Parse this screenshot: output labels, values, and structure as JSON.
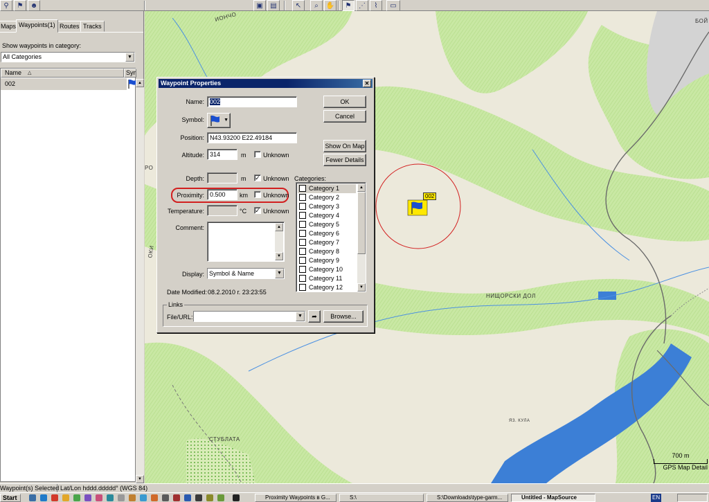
{
  "toolbar": {
    "buttons": [
      "binoculars-find",
      "find-next",
      "find-user",
      "save-waypoint",
      "print",
      "select-tool",
      "zoom-tool",
      "pan-tool",
      "waypoint-tool",
      "route-tool",
      "track-tool",
      "measure-tool"
    ]
  },
  "left_panel": {
    "tabs": [
      {
        "label": "Maps"
      },
      {
        "label": "Waypoints(1)"
      },
      {
        "label": "Routes"
      },
      {
        "label": "Tracks"
      }
    ],
    "show_label": "Show waypoints in category:",
    "category_select": "All Categories",
    "columns": {
      "name": "Name",
      "sym": "Sym"
    },
    "rows": [
      {
        "name": "002"
      }
    ]
  },
  "map": {
    "labels": {
      "top_left": "ИОНЧО",
      "top_right": "БОЙ",
      "river": "НИЩОРСКИ ДОЛ",
      "lake": "ЯЗ. КУЛА",
      "bottom": "СТУБЛАТА",
      "left_a": "РО",
      "left_b": "ОКИ"
    },
    "waypoint_label": "002",
    "scale_text": "700 m",
    "detail_text": "GPS Map Detail"
  },
  "dialog": {
    "title": "Waypoint Properties",
    "labels": {
      "name": "Name:",
      "symbol": "Symbol:",
      "position": "Position:",
      "altitude": "Altitude:",
      "depth": "Depth:",
      "proximity": "Proximity:",
      "temperature": "Temperature:",
      "comment": "Comment:",
      "display": "Display:",
      "date_modified": "Date Modified:",
      "categories": "Categories:",
      "links": "Links",
      "file_url": "File/URL:"
    },
    "values": {
      "name": "002",
      "position": "N43.93200 E22.49184",
      "altitude": "314",
      "altitude_unit": "m",
      "depth": "",
      "depth_unit": "m",
      "proximity": "0.500",
      "proximity_unit": "km",
      "temperature": "",
      "temperature_unit": "°C",
      "comment": "",
      "display": "Symbol & Name",
      "date_modified": "08.2.2010 г. 23:23:55",
      "file_url": ""
    },
    "unknown_label": "Unknown",
    "unknown_checked": {
      "altitude": false,
      "depth": true,
      "proximity": false,
      "temperature": true
    },
    "buttons": {
      "ok": "OK",
      "cancel": "Cancel",
      "show_on_map": "Show On Map",
      "fewer_details": "Fewer Details",
      "browse": "Browse..."
    },
    "categories": [
      "Category 1",
      "Category 2",
      "Category 3",
      "Category 4",
      "Category 5",
      "Category 6",
      "Category 7",
      "Category 8",
      "Category 9",
      "Category 10",
      "Category 11",
      "Category 12"
    ]
  },
  "statusbar": {
    "selection": "Waypoint(s) Selected",
    "coord_format": "Lat/Lon hddd.ddddd° (WGS 84)"
  },
  "taskbar": {
    "start": "Start",
    "tasks": [
      {
        "label": "Proximity Waypoints в G..."
      },
      {
        "label": "S:\\"
      },
      {
        "label": "S:\\Downloads\\type-garm..."
      },
      {
        "label": "Untitled - MapSource"
      }
    ],
    "lang": "EN"
  },
  "colors": {
    "title_bar": "#0a246a",
    "map_bg": "#ece9db",
    "forest": "#c7e6a1",
    "water": "#3c7fd6",
    "highlight": "#d21f1f"
  }
}
